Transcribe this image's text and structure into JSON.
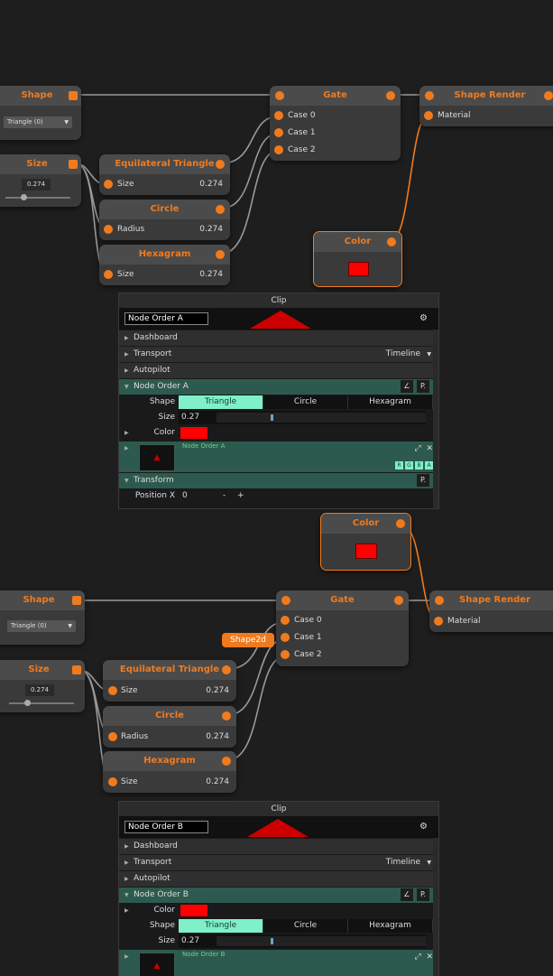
{
  "top": {
    "nodes": {
      "shape": {
        "title": "Shape",
        "dropdown_value": "Triangle (0)"
      },
      "size": {
        "title": "Size",
        "value": "0.274",
        "slider_fraction": 0.274
      },
      "equilateral_triangle": {
        "title": "Equilateral Triangle",
        "port": "Size",
        "value": "0.274"
      },
      "circle": {
        "title": "Circle",
        "port": "Radius",
        "value": "0.274"
      },
      "hexagram": {
        "title": "Hexagram",
        "port": "Size",
        "value": "0.274"
      },
      "gate": {
        "title": "Gate",
        "cases": [
          "Case 0",
          "Case 1",
          "Case 2"
        ]
      },
      "shape_render": {
        "title": "Shape Render",
        "port": "Material"
      },
      "color": {
        "title": "Color",
        "swatch": "#ff0000"
      }
    },
    "panel": {
      "title": "Clip",
      "name_value": "Node Order A",
      "groups": {
        "dashboard": "Dashboard",
        "transport": "Transport",
        "transport_mode": "Timeline",
        "autopilot": "Autopilot",
        "node_order": "Node Order A",
        "transform": "Transform"
      },
      "shape_label": "Shape",
      "shape_options": [
        "Triangle",
        "Circle",
        "Hexagram"
      ],
      "size_label": "Size",
      "size_value": "0.27",
      "color_label": "Color",
      "preview_name": "Node Order A",
      "rgba": [
        "R",
        "G",
        "B",
        "A"
      ],
      "position_label": "Position X",
      "position_value": "0",
      "minus": "-",
      "plus": "+",
      "edit_icon_text": "∠",
      "p_text": "P."
    }
  },
  "bottom": {
    "nodes": {
      "shape": {
        "title": "Shape",
        "dropdown_value": "Triangle (0)"
      },
      "size": {
        "title": "Size",
        "value": "0.274",
        "slider_fraction": 0.274
      },
      "equilateral_triangle": {
        "title": "Equilateral Triangle",
        "port": "Size",
        "value": "0.274"
      },
      "circle": {
        "title": "Circle",
        "port": "Radius",
        "value": "0.274"
      },
      "hexagram": {
        "title": "Hexagram",
        "port": "Size",
        "value": "0.274"
      },
      "gate": {
        "title": "Gate",
        "cases": [
          "Case 0",
          "Case 1",
          "Case 2"
        ]
      },
      "shape_render": {
        "title": "Shape Render",
        "port": "Material"
      },
      "color": {
        "title": "Color",
        "swatch": "#ff0000"
      },
      "wire_tag": "Shape2d"
    },
    "panel": {
      "title": "Clip",
      "name_value": "Node Order B",
      "groups": {
        "dashboard": "Dashboard",
        "transport": "Transport",
        "transport_mode": "Timeline",
        "autopilot": "Autopilot",
        "node_order": "Node Order B"
      },
      "color_label": "Color",
      "shape_label": "Shape",
      "shape_options": [
        "Triangle",
        "Circle",
        "Hexagram"
      ],
      "size_label": "Size",
      "size_value": "0.27",
      "preview_name": "Node Order B",
      "edit_icon_text": "∠",
      "p_text": "P."
    }
  },
  "colors": {
    "accent": "#f07b1f",
    "node_bg": "#3a3a3a",
    "panel_group_open": "#2d5a4e",
    "segment_active": "#7ff0c7",
    "swatch": "#ff0000"
  }
}
